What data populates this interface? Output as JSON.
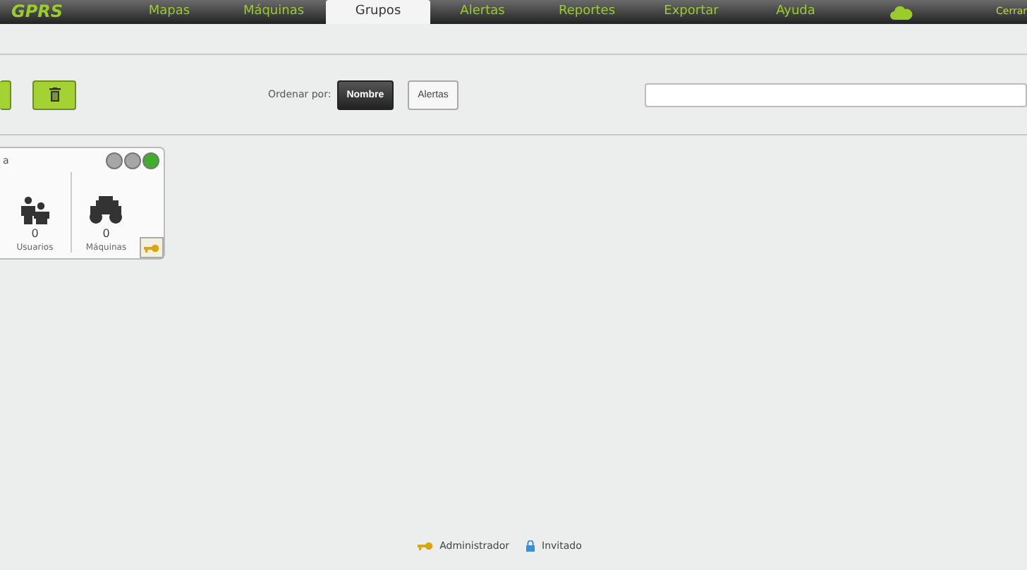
{
  "logo": "GPRS",
  "nav": [
    {
      "label": "Mapas",
      "selected": false
    },
    {
      "label": "Máquinas",
      "selected": false
    },
    {
      "label": "Grupos",
      "selected": true
    },
    {
      "label": "Alertas",
      "selected": false
    },
    {
      "label": "Reportes",
      "selected": false
    },
    {
      "label": "Exportar",
      "selected": false
    },
    {
      "label": "Ayuda",
      "selected": false
    }
  ],
  "logout": "Cerrar",
  "sort": {
    "label": "Ordenar por:",
    "options": [
      {
        "label": "Nombre",
        "selected": true
      },
      {
        "label": "Alertas",
        "selected": false
      }
    ]
  },
  "groups": [
    {
      "title": "a",
      "lights": [
        {
          "color": "#a6a6a6"
        },
        {
          "color": "#a6a6a6"
        },
        {
          "color": "#3fae2a"
        }
      ],
      "users": "0",
      "users_label": "Usuarios",
      "machines": "0",
      "machines_label": "Máquinas"
    }
  ],
  "legend": [
    {
      "kind": "key",
      "label": "Administrador"
    },
    {
      "kind": "lock",
      "label": "Invitado"
    }
  ]
}
